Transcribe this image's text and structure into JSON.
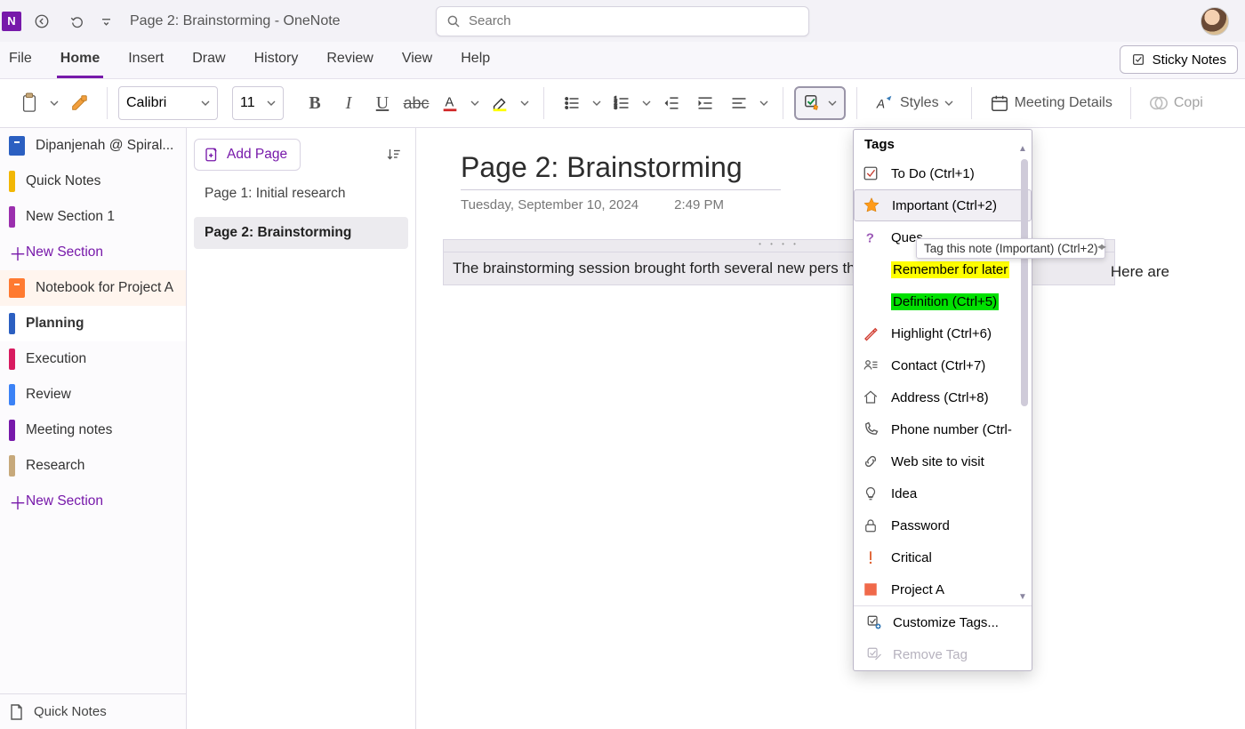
{
  "titlebar": {
    "doc_title": "Page 2: Brainstorming  -  OneNote",
    "search_placeholder": "Search"
  },
  "ribbon_tabs": [
    "File",
    "Home",
    "Insert",
    "Draw",
    "History",
    "Review",
    "View",
    "Help"
  ],
  "ribbon_active_tab_index": 1,
  "sticky_notes_label": "Sticky Notes",
  "ribbon": {
    "font_name": "Calibri",
    "font_size": "11",
    "styles_label": "Styles",
    "meeting_details_label": "Meeting Details",
    "copilot_label": "Copi"
  },
  "sidebar": {
    "items": [
      {
        "type": "notebook",
        "label": "Dipanjenah @ Spiral...",
        "color": "#2b5fc1"
      },
      {
        "type": "section",
        "label": "Quick Notes",
        "color": "#f2b705"
      },
      {
        "type": "section",
        "label": "New Section 1",
        "color": "#9b2fae"
      },
      {
        "type": "new",
        "label": "New Section"
      },
      {
        "type": "notebook",
        "label": "Notebook for Project A",
        "color": "#ff7a30",
        "notebook_row": true
      },
      {
        "type": "section",
        "label": "Planning",
        "color": "#2b5fc1",
        "selected": true
      },
      {
        "type": "section",
        "label": "Execution",
        "color": "#d81b60"
      },
      {
        "type": "section",
        "label": "Review",
        "color": "#3b82f6"
      },
      {
        "type": "section",
        "label": "Meeting notes",
        "color": "#7719aa"
      },
      {
        "type": "section",
        "label": "Research",
        "color": "#c7a97b"
      },
      {
        "type": "new",
        "label": "New Section"
      }
    ],
    "footer_label": "Quick Notes"
  },
  "pagelist": {
    "add_label": "Add Page",
    "pages": [
      {
        "label": "Page 1: Initial research",
        "selected": false
      },
      {
        "label": "Page 2: Brainstorming",
        "selected": true
      }
    ]
  },
  "canvas": {
    "title": "Page 2: Brainstorming",
    "date": "Tuesday, September 10, 2024",
    "time": "2:49 PM",
    "note_text": "The brainstorming session brought forth several new pers the top takeaways…",
    "note_overflow_text": "Here are"
  },
  "tags_dropdown": {
    "header": "Tags",
    "items": [
      {
        "label": "To Do (Ctrl+1)",
        "icon": "todo"
      },
      {
        "label": "Important (Ctrl+2)",
        "icon": "star",
        "hover": true
      },
      {
        "label": "Ques",
        "icon": "question"
      },
      {
        "label": "Remember for later",
        "icon": "none",
        "style": "yellow"
      },
      {
        "label": "Definition (Ctrl+5)",
        "icon": "none",
        "style": "green"
      },
      {
        "label": "Highlight (Ctrl+6)",
        "icon": "pencil"
      },
      {
        "label": "Contact (Ctrl+7)",
        "icon": "contact"
      },
      {
        "label": "Address (Ctrl+8)",
        "icon": "home"
      },
      {
        "label": "Phone number (Ctrl-",
        "icon": "phone"
      },
      {
        "label": "Web site to visit",
        "icon": "link"
      },
      {
        "label": "Idea",
        "icon": "bulb"
      },
      {
        "label": "Password",
        "icon": "lock"
      },
      {
        "label": "Critical",
        "icon": "exclaim"
      },
      {
        "label": "Project A",
        "icon": "square",
        "color": "#f0694a"
      }
    ],
    "customize_label": "Customize Tags...",
    "remove_label": "Remove Tag",
    "tooltip": "Tag this note (Important) (Ctrl+2)"
  }
}
